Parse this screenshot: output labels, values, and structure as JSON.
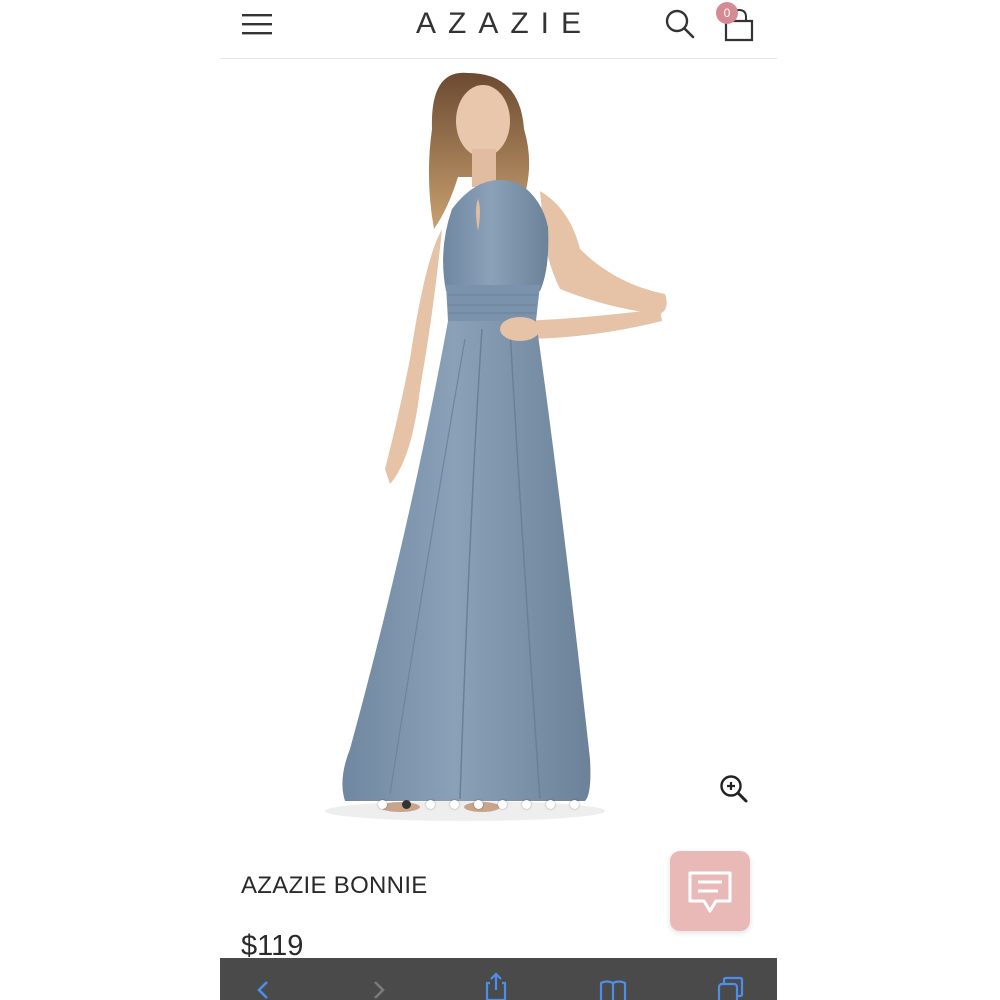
{
  "header": {
    "brand": "AZAZIE",
    "cart_count": "0",
    "icons": {
      "menu": "hamburger-menu-icon",
      "search": "search-icon",
      "cart": "shopping-bag-icon"
    }
  },
  "gallery": {
    "slides_total": 9,
    "active_slide": 2,
    "zoom_icon": "zoom-in-icon"
  },
  "product": {
    "name": "AZAZIE BONNIE",
    "price": "$119"
  },
  "chat": {
    "icon": "chat-bubble-icon"
  },
  "colors": {
    "accent_pink": "#e9b9b8",
    "badge_pink": "#d68a94",
    "dress_dusty_blue": "#7d95ae",
    "toolbar": "#4a4a4a"
  },
  "browser_toolbar": {
    "icons": [
      "back-icon",
      "forward-icon",
      "share-icon",
      "bookmarks-icon",
      "tabs-icon"
    ]
  }
}
